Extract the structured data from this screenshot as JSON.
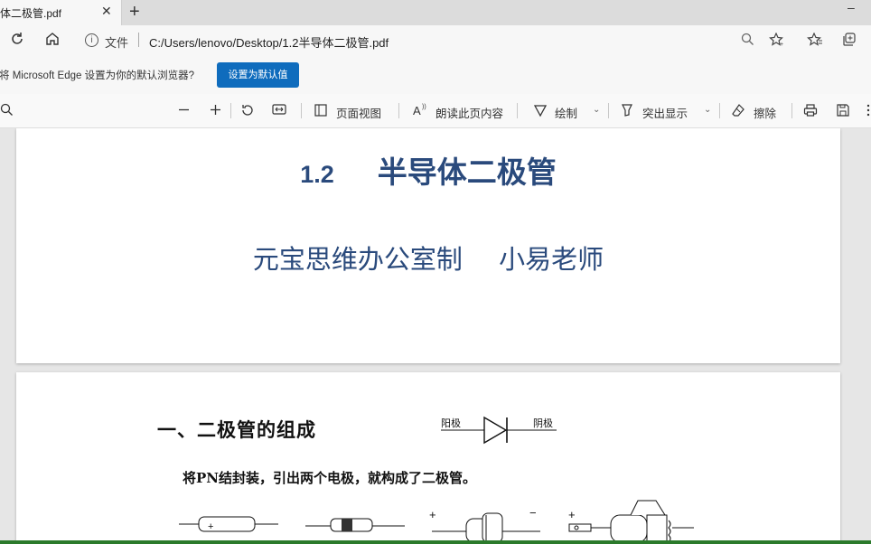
{
  "tab": {
    "title": "体二极管.pdf",
    "close": "✕",
    "new_tab": "+"
  },
  "window": {
    "minimize": "–"
  },
  "address": {
    "file_label": "文件",
    "url": "C:/Users/lenovo/Desktop/1.2半导体二极管.pdf"
  },
  "infobar": {
    "message": "将 Microsoft Edge 设置为你的默认浏览器?",
    "button": "设置为默认值"
  },
  "toolbar": {
    "page_view": "页面视图",
    "read_aloud": "朗读此页内容",
    "draw": "绘制",
    "highlight": "突出显示",
    "erase": "擦除"
  },
  "page1": {
    "title_number": "1.2",
    "title_text": "半导体二极管",
    "subtitle": "元宝思维办公室制     小易老师"
  },
  "page2": {
    "heading": "一、二极管的组成",
    "anode_label": "阳极",
    "cathode_label": "阴极",
    "description": "将PN结封装，引出两个电极，就构成了二极管。",
    "plus_sign": "+",
    "minus_sign": "−"
  },
  "icons": [
    "close-icon",
    "new-tab-icon",
    "refresh-icon",
    "home-icon",
    "info-icon",
    "zoom-icon",
    "favorite-add-icon",
    "favorites-icon",
    "collections-icon",
    "search-icon",
    "zoom-out-icon",
    "zoom-in-icon",
    "rotate-icon",
    "fit-icon",
    "page-view-icon",
    "read-aloud-icon",
    "draw-icon",
    "highlight-icon",
    "eraser-icon",
    "print-icon",
    "save-icon"
  ]
}
